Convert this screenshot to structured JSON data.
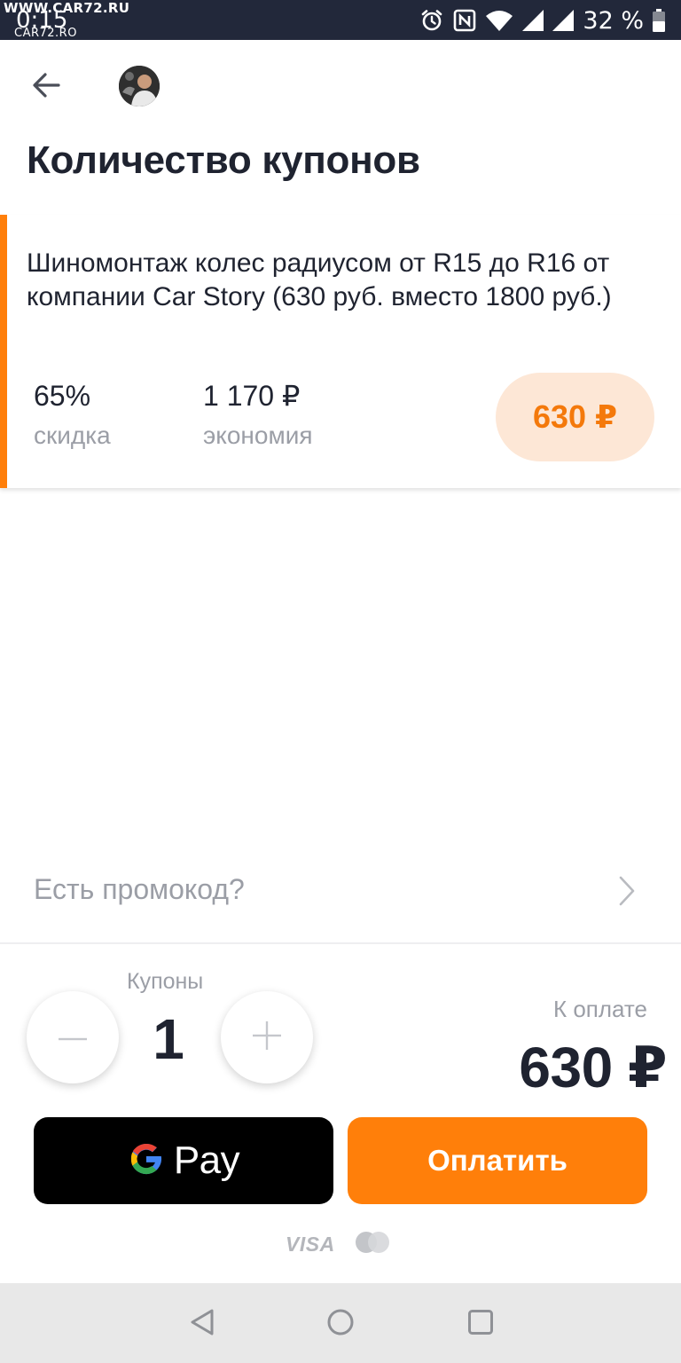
{
  "status_bar": {
    "watermark_top": "WWW.CAR72.RU",
    "time": "0:15",
    "watermark_bottom": "CAR72.RO",
    "battery": "32 %",
    "icons": [
      "alarm-icon",
      "nfc-icon",
      "wifi-icon",
      "signal-icon",
      "signal-icon",
      "battery-icon"
    ]
  },
  "header": {
    "back_icon": "arrow-left-icon",
    "title": "Количество купонов"
  },
  "coupon": {
    "description": "Шиномонтаж колес радиусом от R15 до R16 от компании Car Story (630 руб. вместо 1800 руб.)",
    "discount_value": "65%",
    "discount_label": "скидка",
    "savings_value": "1 170 ₽",
    "savings_label": "экономия",
    "price": "630 ₽"
  },
  "promo": {
    "label": "Есть промокод?"
  },
  "quantity": {
    "label": "Купоны",
    "value": "1",
    "decrement_icon": "minus-icon",
    "increment_icon": "plus-icon"
  },
  "total": {
    "label": "К оплате",
    "amount": "630 ₽"
  },
  "actions": {
    "gpay_label": "Pay",
    "pay_label": "Оплатить"
  },
  "payment_logos": {
    "visa": "VISA"
  },
  "colors": {
    "accent": "#ff7f0a",
    "accent_light": "#fde7d6",
    "status_bar": "#22283a",
    "text_primary": "#1f2330",
    "text_secondary": "#9b9ea6"
  }
}
